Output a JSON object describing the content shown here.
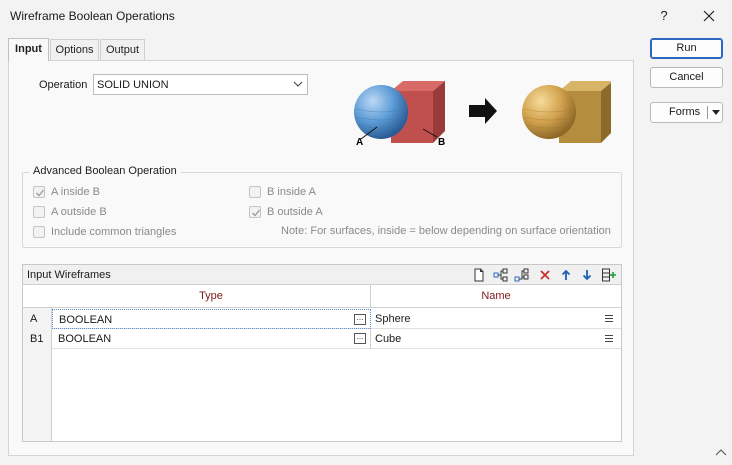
{
  "window": {
    "title": "Wireframe Boolean Operations",
    "help_label": "?"
  },
  "tabs": [
    {
      "label": "Input",
      "active": true
    },
    {
      "label": "Options",
      "active": false
    },
    {
      "label": "Output",
      "active": false
    }
  ],
  "operation": {
    "label": "Operation",
    "value": "SOLID UNION"
  },
  "illustration": {
    "label_a": "A",
    "label_b": "B",
    "colors": {
      "sphere": "#5b9bd5",
      "cube": "#c0504d",
      "result": "#c9a24a"
    }
  },
  "advanced": {
    "title": "Advanced Boolean Operation",
    "options": [
      {
        "label": "A inside B",
        "checked": true
      },
      {
        "label": "B inside A",
        "checked": false
      },
      {
        "label": "A outside B",
        "checked": false
      },
      {
        "label": "B outside A",
        "checked": true
      },
      {
        "label": "Include common triangles",
        "checked": false
      }
    ],
    "note": "Note: For surfaces, inside = below depending on surface orientation"
  },
  "grid": {
    "title": "Input Wireframes",
    "toolbar_icons": [
      "new-page-icon",
      "insert-row-icon",
      "append-row-icon",
      "delete-icon",
      "move-up-icon",
      "move-down-icon",
      "add-column-icon"
    ],
    "columns": [
      "Type",
      "Name"
    ],
    "rows": [
      {
        "id": "A",
        "type": "BOOLEAN",
        "name": "Sphere"
      },
      {
        "id": "B1",
        "type": "BOOLEAN",
        "name": "Cube"
      }
    ]
  },
  "buttons": {
    "run": "Run",
    "cancel": "Cancel",
    "forms": "Forms"
  },
  "accent_color": "#2b68c4"
}
